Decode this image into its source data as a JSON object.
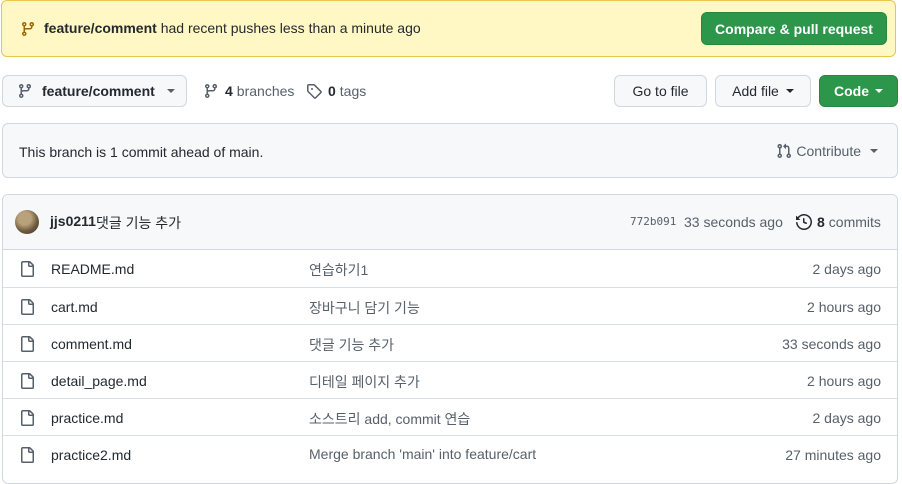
{
  "banner": {
    "branch": "feature/comment",
    "message": "had recent pushes less than a minute ago",
    "compare_button": "Compare & pull request"
  },
  "toolbar": {
    "branch_label": "feature/comment",
    "branches_count": "4",
    "branches_label": "branches",
    "tags_count": "0",
    "tags_label": "tags",
    "goto_file": "Go to file",
    "add_file": "Add file",
    "code": "Code"
  },
  "ahead": {
    "text": "This branch is 1 commit ahead of main.",
    "contribute": "Contribute"
  },
  "latest_commit": {
    "author": "jjs0211",
    "message": "댓글 기능 추가",
    "sha": "772b091",
    "time": "33 seconds ago",
    "commits_count": "8",
    "commits_label": "commits"
  },
  "files": [
    {
      "name": "README.md",
      "message": "연습하기1",
      "age": "2 days ago"
    },
    {
      "name": "cart.md",
      "message": "장바구니 담기 기능",
      "age": "2 hours ago"
    },
    {
      "name": "comment.md",
      "message": "댓글 기능 추가",
      "age": "33 seconds ago"
    },
    {
      "name": "detail_page.md",
      "message": "디테일 페이지 추가",
      "age": "2 hours ago"
    },
    {
      "name": "practice.md",
      "message": "소스트리 add, commit 연습",
      "age": "2 days ago"
    },
    {
      "name": "practice2.md",
      "message": "Merge branch 'main' into feature/cart",
      "age": "27 minutes ago"
    }
  ],
  "icons": {
    "branch": "git-branch-icon",
    "tag": "tag-icon",
    "history": "history-icon",
    "pull_request": "git-pull-request-icon",
    "file": "file-icon"
  },
  "colors": {
    "banner_bg": "#fff8c5",
    "green_button": "#2c974b",
    "muted_text": "#57606a"
  }
}
